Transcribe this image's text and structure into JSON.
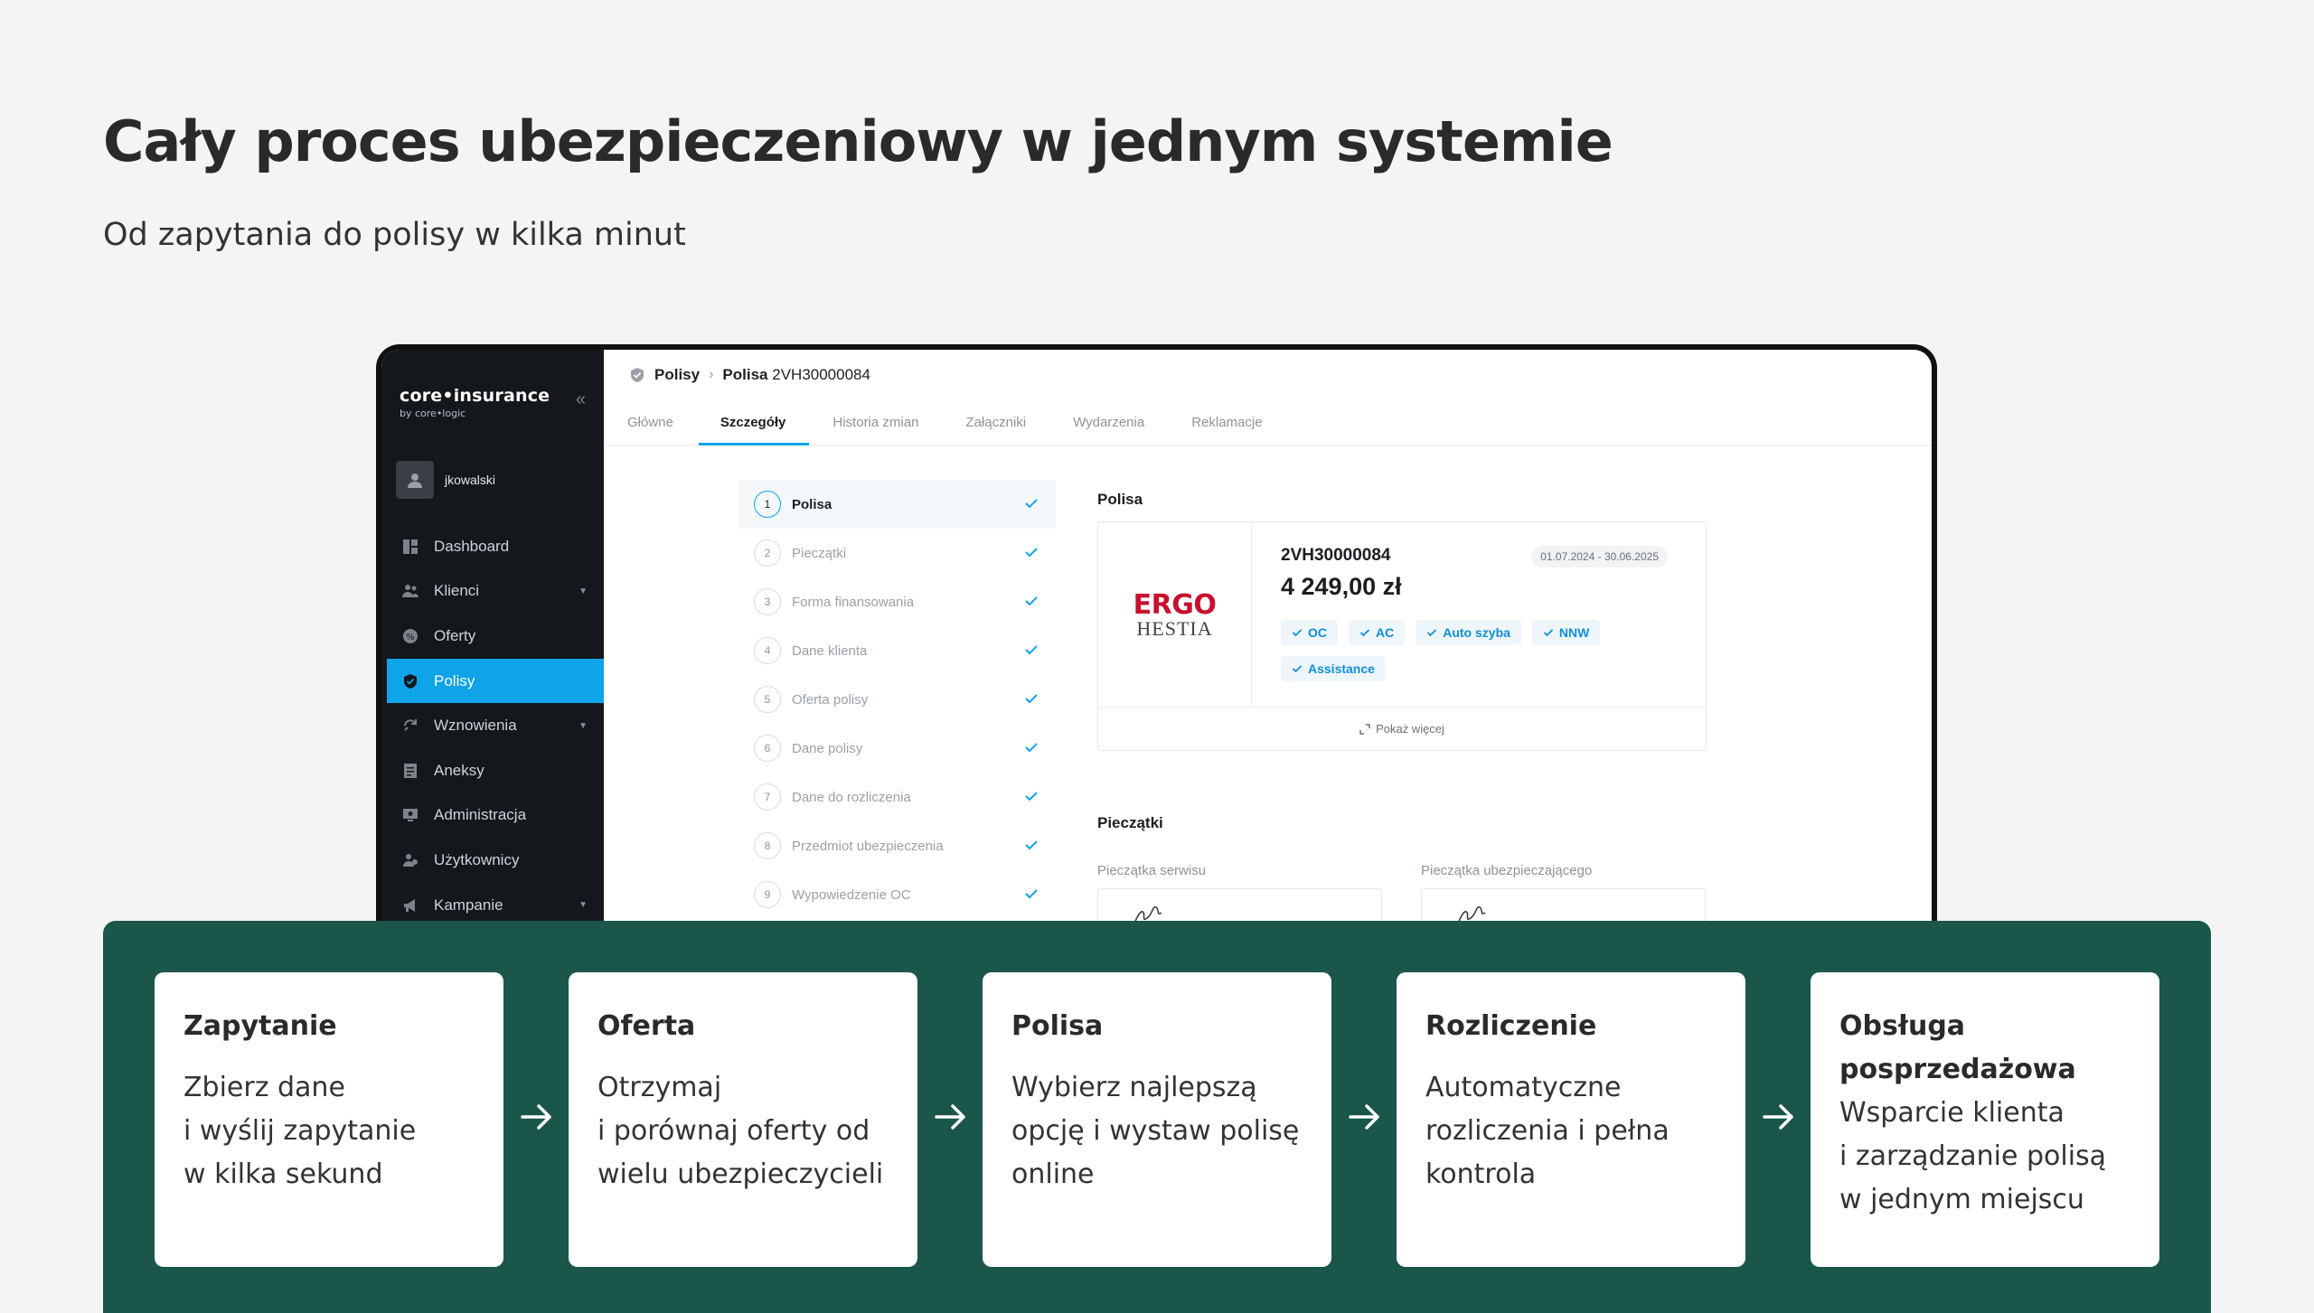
{
  "hero": {
    "title": "Cały proces ubezpieczeniowy w jednym systemie",
    "subtitle": "Od zapytania do polisy w kilka minut"
  },
  "app": {
    "logo_main": "core•insurance",
    "logo_sub": "by core•logic",
    "collapse_icon": "double-chevron-left-icon",
    "user": "jkowalski",
    "nav": [
      {
        "label": "Dashboard",
        "icon": "dashboard-icon",
        "caret": ""
      },
      {
        "label": "Klienci",
        "icon": "users-icon",
        "caret": "▼"
      },
      {
        "label": "Oferty",
        "icon": "offers-icon",
        "caret": ""
      },
      {
        "label": "Polisy",
        "icon": "shield-icon",
        "caret": "",
        "active": true
      },
      {
        "label": "Wznowienia",
        "icon": "renew-icon",
        "caret": "▼"
      },
      {
        "label": "Aneksy",
        "icon": "document-icon",
        "caret": ""
      },
      {
        "label": "Administracja",
        "icon": "admin-icon",
        "caret": ""
      },
      {
        "label": "Użytkownicy",
        "icon": "user-group-icon",
        "caret": ""
      },
      {
        "label": "Kampanie",
        "icon": "megaphone-icon",
        "caret": "▼"
      }
    ],
    "breadcrumb": {
      "root": "Polisy",
      "current_bold": "Polisa",
      "current_id": "2VH30000084"
    },
    "tabs": [
      "Główne",
      "Szczegóły",
      "Historia zmian",
      "Załączniki",
      "Wydarzenia",
      "Reklamacje"
    ],
    "active_tab": "Szczegóły",
    "steps": [
      {
        "num": "1",
        "label": "Polisa"
      },
      {
        "num": "2",
        "label": "Pieczątki"
      },
      {
        "num": "3",
        "label": "Forma finansowania"
      },
      {
        "num": "4",
        "label": "Dane klienta"
      },
      {
        "num": "5",
        "label": "Oferta polisy"
      },
      {
        "num": "6",
        "label": "Dane polisy"
      },
      {
        "num": "7",
        "label": "Dane do rozliczenia"
      },
      {
        "num": "8",
        "label": "Przedmiot ubezpieczenia"
      },
      {
        "num": "9",
        "label": "Wypowiedzenie OC"
      }
    ],
    "policy": {
      "section_title": "Polisa",
      "insurer_line1": "ERGO",
      "insurer_line2": "HESTIA",
      "number": "2VH30000084",
      "dates": "01.07.2024 - 30.06.2025",
      "price": "4 249,00 zł",
      "coverages": [
        "OC",
        "AC",
        "Auto szyba",
        "NNW",
        "Assistance"
      ],
      "show_more": "Pokaż więcej"
    },
    "stamps": {
      "section_title": "Pieczątki",
      "service_label": "Pieczątka serwisu",
      "insurer_label": "Pieczątka ubezpieczającego"
    }
  },
  "flow": {
    "accent_color": "#1a574a",
    "steps": [
      {
        "title": "Zapytanie",
        "text": "Zbierz dane\ni wyślij zapytanie\nw kilka sekund"
      },
      {
        "title": "Oferta",
        "text": "Otrzymaj\ni porównaj oferty od\nwielu ubezpieczycieli"
      },
      {
        "title": "Polisa",
        "text": "Wybierz najlepszą\nopcję i wystaw polisę\nonline"
      },
      {
        "title": "Rozliczenie",
        "text": "Automatyczne\nrozliczenia i pełna\nkontrola"
      },
      {
        "title": "Obsługa\nposprzedażowa",
        "text": "Wsparcie klienta\ni zarządzanie polisą\nw jednym miejscu"
      }
    ]
  }
}
